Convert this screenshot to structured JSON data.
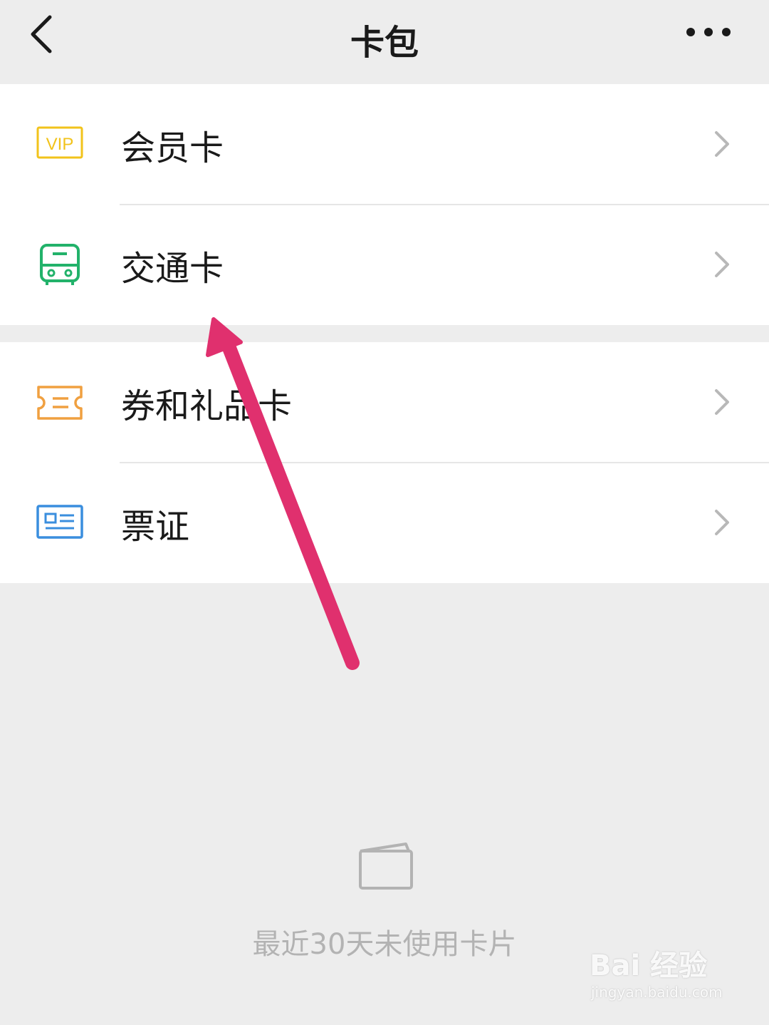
{
  "header": {
    "title": "卡包"
  },
  "menu": {
    "groups": [
      {
        "items": [
          {
            "label": "会员卡",
            "icon": "vip-icon",
            "icon_text": "VIP",
            "color": "#f2c31b"
          },
          {
            "label": "交通卡",
            "icon": "bus-icon",
            "color": "#22b26a"
          }
        ]
      },
      {
        "items": [
          {
            "label": "券和礼品卡",
            "icon": "coupon-icon",
            "color": "#f0a040"
          },
          {
            "label": "票证",
            "icon": "id-card-icon",
            "color": "#3a8ede"
          }
        ]
      }
    ]
  },
  "empty_state": {
    "icon": "card-wallet-icon",
    "text": "最近30天未使用卡片"
  },
  "annotation": {
    "arrow_color": "#e0306e"
  },
  "watermark": {
    "main": "Bai 经验",
    "sub": "jingyan.baidu.com"
  }
}
